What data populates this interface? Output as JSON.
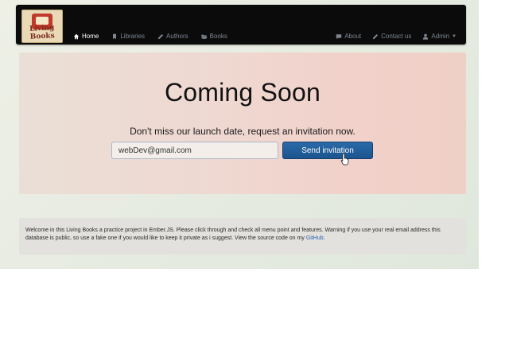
{
  "brand": {
    "logo_text": "Living Books"
  },
  "nav": {
    "left": [
      {
        "label": "Home",
        "icon": "home-icon",
        "active": true
      },
      {
        "label": "Libraries",
        "icon": "bookmark-icon",
        "active": false
      },
      {
        "label": "Authors",
        "icon": "pencil-icon",
        "active": false
      },
      {
        "label": "Books",
        "icon": "folder-open-icon",
        "active": false
      }
    ],
    "right": [
      {
        "label": "About",
        "icon": "comment-icon"
      },
      {
        "label": "Contact us",
        "icon": "pencil-icon"
      },
      {
        "label": "Admin",
        "icon": "user-icon"
      }
    ]
  },
  "hero": {
    "title": "Coming Soon",
    "subtitle": "Don't miss our launch date, request an invitation now.",
    "email_value": "webDev@gmail.com",
    "button_label": "Send invitation"
  },
  "info": {
    "text": "Welcome in this Living Books a practice project in Ember.JS. Please click through and check all menu point and features. Warning if you use your real email address this database is public, so use a fake one if you would like to keep it private as i suggest. View the source code on my",
    "link_text": "GitHub",
    "end": "."
  },
  "colors": {
    "navbar": "#0b0b0b",
    "button": "#1b548f",
    "jumbotron": "#efd8d1",
    "link": "#2c62b5"
  }
}
